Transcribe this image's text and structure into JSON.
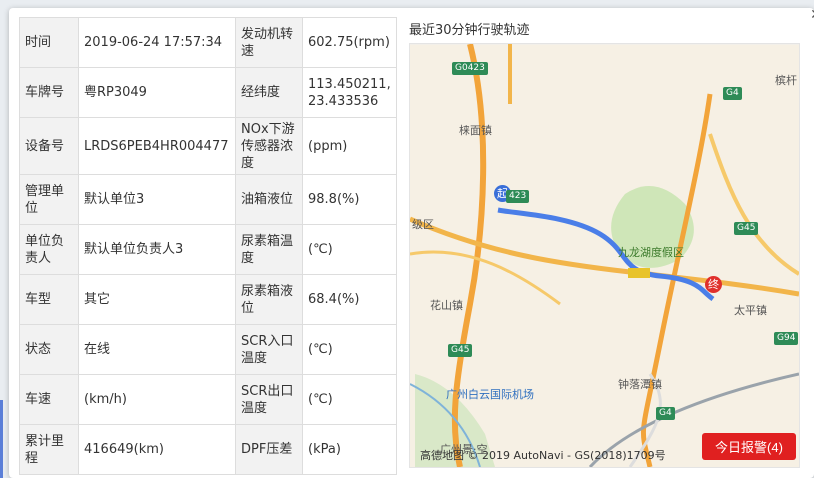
{
  "info_rows": [
    {
      "k1": "时间",
      "v1": "2019-06-24 17:57:34",
      "k2": "发动机转速",
      "v2": "602.75(rpm)"
    },
    {
      "k1": "车牌号",
      "v1": "粤RP3049",
      "k2": "经纬度",
      "v2": "113.450211,\n23.433536"
    },
    {
      "k1": "设备号",
      "v1": "LRDS6PEB4HR004477",
      "k2": "NOx下游传感器浓度",
      "v2": "(ppm)"
    },
    {
      "k1": "管理单位",
      "v1": "默认单位3",
      "k2": "油箱液位",
      "v2": "98.8(%)"
    },
    {
      "k1": "单位负责人",
      "v1": "默认单位负责人3",
      "k2": "尿素箱温度",
      "v2": "(℃)"
    },
    {
      "k1": "车型",
      "v1": "其它",
      "k2": "尿素箱液位",
      "v2": "68.4(%)"
    },
    {
      "k1": "状态",
      "v1": "在线",
      "k2": "SCR入口温度",
      "v2": "(℃)"
    },
    {
      "k1": "车速",
      "v1": "(km/h)",
      "k2": "SCR出口温度",
      "v2": "(℃)"
    },
    {
      "k1": "累计里程",
      "v1": "416649(km)",
      "k2": "DPF压差",
      "v2": "(kPa)"
    }
  ],
  "map": {
    "title": "最近30分钟行驶轨迹",
    "start_marker": "起",
    "end_marker": "终",
    "labels": {
      "jiulong": "九龙湖度假区",
      "huashan": "花山镇",
      "airport": "广州白云国际机场",
      "taiping": "太平镇",
      "zhongluotan": "钟落潭镇",
      "jimianzhen": "梾面镇",
      "jiqu": "级区",
      "qiaotou": "槟杆",
      "huadu": "广州景·空"
    },
    "road_shields": [
      "G0423",
      "G4",
      "G45",
      "G45",
      "G94",
      "G4",
      "G45",
      "423"
    ],
    "copyright": "高德地图 © 2019 AutoNavi - GS(2018)1709号"
  },
  "report_button": "今日报警(4)",
  "colors": {
    "track": "#4a7ee8",
    "report": "#e02020",
    "start": "#3a6fd8",
    "end": "#e0302c"
  }
}
